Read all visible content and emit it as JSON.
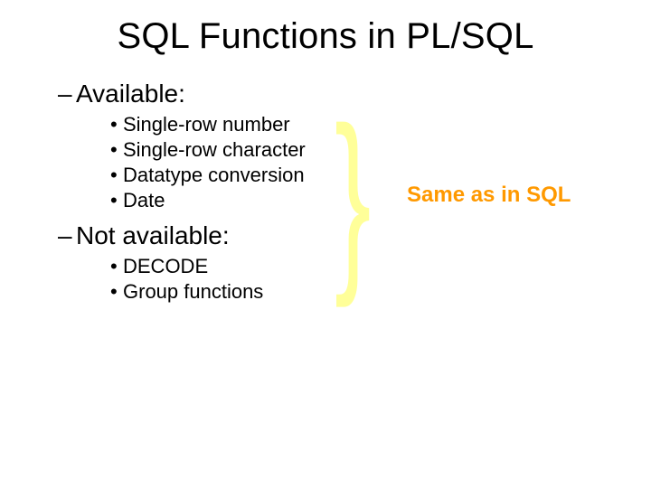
{
  "title": "SQL Functions in PL/SQL",
  "sections": {
    "available": {
      "label": "Available:",
      "items": [
        "Single-row number",
        "Single-row character",
        "Datatype conversion",
        "Date"
      ]
    },
    "not_available": {
      "label": "Not available:",
      "items": [
        "DECODE",
        "Group functions"
      ]
    }
  },
  "annotation": "Same as in SQL",
  "brace_glyph": "}",
  "colors": {
    "brace": "#ffff99",
    "annotation": "#ff9900"
  }
}
